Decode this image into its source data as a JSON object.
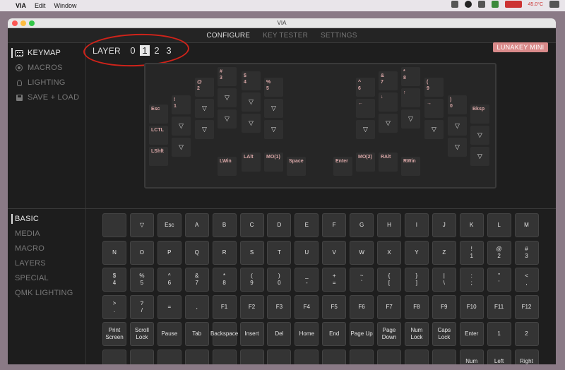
{
  "menubar": {
    "apple": "",
    "app": "VIA",
    "items": [
      "Edit",
      "Window"
    ]
  },
  "tray": {
    "temp": "45.0°C"
  },
  "window": {
    "title": "VIA"
  },
  "nav": {
    "tabs": [
      {
        "label": "CONFIGURE",
        "active": true
      },
      {
        "label": "KEY TESTER",
        "active": false
      },
      {
        "label": "SETTINGS",
        "active": false
      }
    ]
  },
  "sidebar": {
    "items": [
      {
        "label": "KEYMAP",
        "icon": "keyboard-icon",
        "active": true
      },
      {
        "label": "MACROS",
        "icon": "macro-icon",
        "active": false
      },
      {
        "label": "LIGHTING",
        "icon": "lightbulb-icon",
        "active": false
      },
      {
        "label": "SAVE + LOAD",
        "icon": "save-icon",
        "active": false
      }
    ],
    "categories": [
      {
        "label": "BASIC",
        "active": true
      },
      {
        "label": "MEDIA",
        "active": false
      },
      {
        "label": "MACRO",
        "active": false
      },
      {
        "label": "LAYERS",
        "active": false
      },
      {
        "label": "SPECIAL",
        "active": false
      },
      {
        "label": "QMK LIGHTING",
        "active": false
      }
    ]
  },
  "layer": {
    "label": "LAYER",
    "options": [
      "0",
      "1",
      "2",
      "3"
    ],
    "selected": "1"
  },
  "keyboard_name": "LUNAKEY MINI",
  "layout_keys": [
    {
      "label": "Esc"
    },
    {
      "label": "!\n1"
    },
    {
      "label": "@\n2"
    },
    {
      "label": "#\n3"
    },
    {
      "label": "$\n4"
    },
    {
      "label": "%\n5"
    },
    {
      "label": "^\n6"
    },
    {
      "label": "&\n7"
    },
    {
      "label": "*\n8"
    },
    {
      "label": "(\n9"
    },
    {
      "label": ")\n0"
    },
    {
      "label": "Bksp"
    },
    {
      "label": "LCTL"
    },
    {
      "label": "▽"
    },
    {
      "label": "▽"
    },
    {
      "label": "▽"
    },
    {
      "label": "▽"
    },
    {
      "label": "▽"
    },
    {
      "label": "←"
    },
    {
      "label": "↓"
    },
    {
      "label": "↑"
    },
    {
      "label": "→"
    },
    {
      "label": "▽"
    },
    {
      "label": "▽"
    },
    {
      "label": "LShft"
    },
    {
      "label": "▽"
    },
    {
      "label": "▽"
    },
    {
      "label": "▽"
    },
    {
      "label": "▽"
    },
    {
      "label": "▽"
    },
    {
      "label": "▽"
    },
    {
      "label": "▽"
    },
    {
      "label": "▽"
    },
    {
      "label": "▽"
    },
    {
      "label": "▽"
    },
    {
      "label": "▽"
    },
    {
      "label": "LWin"
    },
    {
      "label": "LAlt"
    },
    {
      "label": "MO(1)"
    },
    {
      "label": "Space"
    },
    {
      "label": "Enter"
    },
    {
      "label": "MO(2)"
    },
    {
      "label": "RAlt"
    },
    {
      "label": "RWin"
    }
  ],
  "basic_keys": [
    "",
    "▽",
    "Esc",
    "A",
    "B",
    "C",
    "D",
    "E",
    "F",
    "G",
    "H",
    "I",
    "J",
    "K",
    "L",
    "M",
    "N",
    "O",
    "P",
    "Q",
    "R",
    "S",
    "T",
    "U",
    "V",
    "W",
    "X",
    "Y",
    "Z",
    "!\n1",
    "@\n2",
    "#\n3",
    "$\n4",
    "%\n5",
    "^\n6",
    "&\n7",
    "*\n8",
    "(\n9",
    ")\n0",
    "_\n-",
    "+\n=",
    "~\n`",
    "{\n[",
    "}\n]",
    "|\n\\",
    ":\n;",
    "\"\n'",
    "<\n,",
    ">\n.",
    "?\n/",
    "=",
    ",",
    "F1",
    "F2",
    "F3",
    "F4",
    "F5",
    "F6",
    "F7",
    "F8",
    "F9",
    "F10",
    "F11",
    "F12",
    "Print\nScreen",
    "Scroll\nLock",
    "Pause",
    "Tab",
    "Backspace",
    "Insert",
    "Del",
    "Home",
    "End",
    "Page Up",
    "Page\nDown",
    "Num\nLock",
    "Caps\nLock",
    "Enter",
    "1",
    "2",
    "",
    "",
    "",
    "",
    "",
    "",
    "",
    "",
    "",
    "",
    "",
    "",
    "",
    "Num",
    "Left",
    "Right"
  ],
  "colors": {
    "accent_badge": "#d98a8a",
    "legend": "#d9a7a7",
    "annotation": "#d0231a"
  }
}
